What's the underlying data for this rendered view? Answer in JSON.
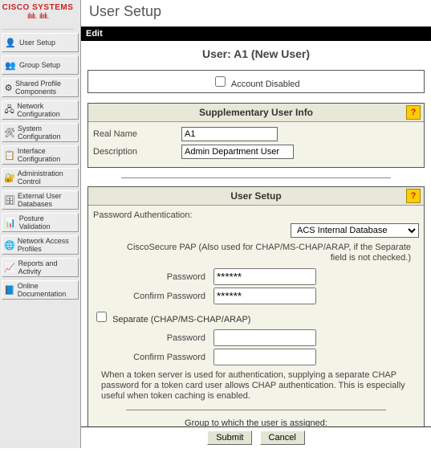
{
  "logo": {
    "brand": "CISCO SYSTEMS"
  },
  "page_title": "User Setup",
  "edit_label": "Edit",
  "sidebar": {
    "items": [
      {
        "label": "User Setup",
        "icon": "👤"
      },
      {
        "label": "Group Setup",
        "icon": "👥"
      },
      {
        "label": "Shared Profile Components",
        "icon": "⚙"
      },
      {
        "label": "Network Configuration",
        "icon": "🖧"
      },
      {
        "label": "System Configuration",
        "icon": "🛠"
      },
      {
        "label": "Interface Configuration",
        "icon": "📋"
      },
      {
        "label": "Administration Control",
        "icon": "🔐"
      },
      {
        "label": "External User Databases",
        "icon": "🗄"
      },
      {
        "label": "Posture Validation",
        "icon": "📊"
      },
      {
        "label": "Network Access Profiles",
        "icon": "🌐"
      },
      {
        "label": "Reports and Activity",
        "icon": "📈"
      },
      {
        "label": "Online Documentation",
        "icon": "📘"
      }
    ]
  },
  "user_heading": "User: A1 (New User)",
  "account_disabled": {
    "label": "Account Disabled",
    "checked": false
  },
  "supplementary": {
    "heading": "Supplementary User Info",
    "real_name_label": "Real Name",
    "real_name_value": "A1",
    "description_label": "Description",
    "description_value": "Admin Department User"
  },
  "user_setup": {
    "heading": "User Setup",
    "pa_label": "Password Authentication:",
    "db_selected": "ACS Internal Database",
    "cisco_note": "CiscoSecure PAP (Also used for CHAP/MS-CHAP/ARAP, if the Separate field is not checked.)",
    "password_label": "Password",
    "confirm_label": "Confirm Password",
    "password_value": "******",
    "confirm_value": "******",
    "separate_label": "Separate (CHAP/MS-CHAP/ARAP)",
    "separate_checked": false,
    "sep_password_value": "",
    "sep_confirm_value": "",
    "token_note": "When a token server is used for authentication, supplying a separate CHAP password for a token card user allows CHAP authentication. This is especially useful when token caching is enabled.",
    "group_label": "Group to which the user is assigned:"
  },
  "footer": {
    "submit": "Submit",
    "cancel": "Cancel"
  }
}
